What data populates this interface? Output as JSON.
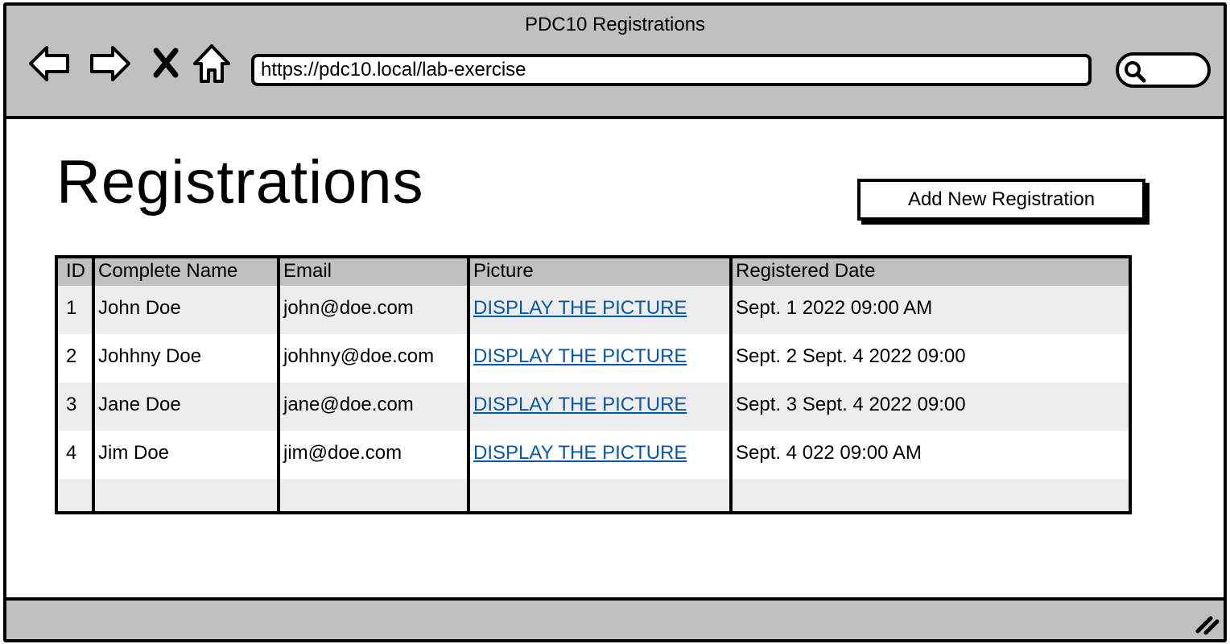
{
  "window": {
    "title": "PDC10 Registrations"
  },
  "browser": {
    "url": "https://pdc10.local/lab-exercise",
    "search_placeholder": "",
    "icons": [
      "back-arrow-icon",
      "forward-arrow-icon",
      "close-icon",
      "home-icon",
      "search-icon",
      "resize-grip-icon"
    ]
  },
  "page": {
    "title": "Registrations",
    "add_button": "Add New Registration"
  },
  "table": {
    "columns": [
      "ID",
      "Complete Name",
      "Email",
      "Picture",
      "Registered Date"
    ],
    "rows": [
      {
        "id": "1",
        "name": "John Doe",
        "email": "john@doe.com",
        "picture": "DISPLAY THE PICTURE",
        "date": "Sept. 1 2022 09:00 AM"
      },
      {
        "id": "2",
        "name": "Johhny Doe",
        "email": "johhny@doe.com",
        "picture": "DISPLAY THE PICTURE",
        "date": "Sept. 2 Sept. 4 2022 09:00"
      },
      {
        "id": "3",
        "name": "Jane Doe",
        "email": "jane@doe.com",
        "picture": "DISPLAY THE PICTURE",
        "date": "Sept. 3 Sept. 4 2022 09:00"
      },
      {
        "id": "4",
        "name": "Jim Doe",
        "email": "jim@doe.com",
        "picture": "DISPLAY THE PICTURE",
        "date": "Sept. 4 022 09:00 AM"
      }
    ]
  },
  "colors": {
    "chrome": "#c0c0c0",
    "link": "#0c57a3",
    "row_alt": "#ededed"
  }
}
